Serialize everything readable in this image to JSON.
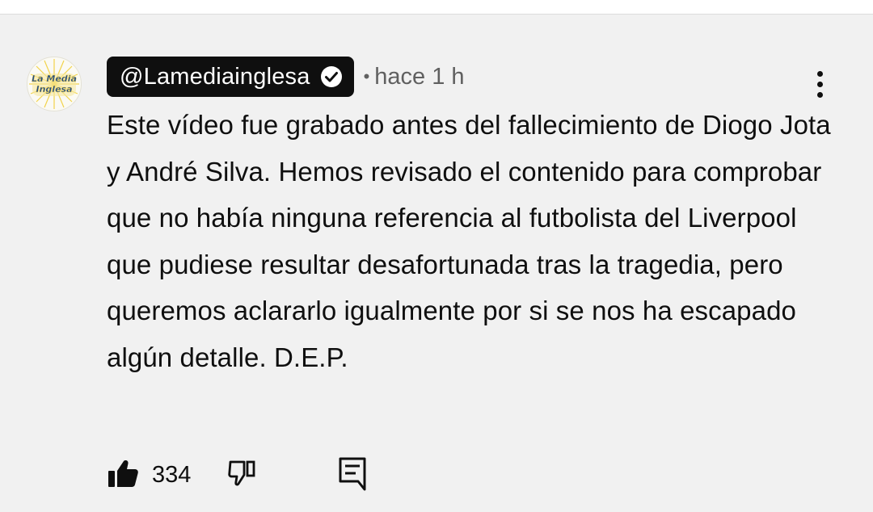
{
  "comment": {
    "author": "@Lamediainglesa",
    "verified": true,
    "separator": "•",
    "timestamp": "hace 1 h",
    "avatar": {
      "logo_text_line1": "La Media",
      "logo_text_line2": "Inglesa"
    },
    "text": "Este vídeo fue grabado antes del fallecimiento de Diogo Jota y André Silva. Hemos revisado el contenido para comprobar que no había ninguna referencia al futbolista del Liverpool que pudiese resultar desafortunada tras la tragedia, pero queremos aclararlo igualmente por si se nos ha escapado algún detalle. D.E.P.",
    "likes": "334",
    "icons": {
      "verified": "check-circle-icon",
      "menu": "more-vert-icon",
      "like": "thumbs-up-filled-icon",
      "dislike": "thumbs-down-outline-icon",
      "reply": "comment-reply-icon"
    }
  },
  "colors": {
    "background": "#f1f1f1",
    "text": "#0f0f0f",
    "secondary_text": "#606060",
    "author_chip": "#0f0f0f"
  }
}
